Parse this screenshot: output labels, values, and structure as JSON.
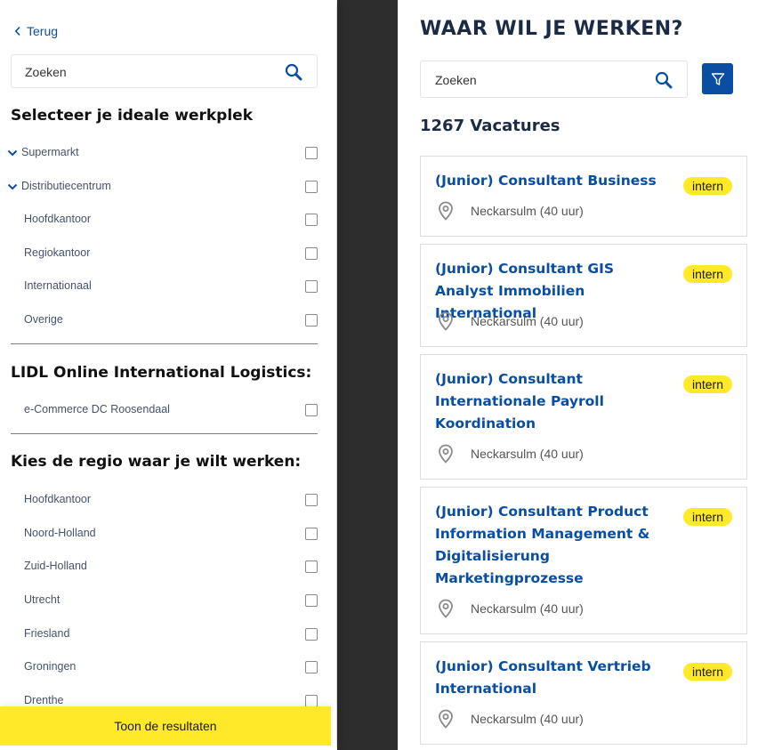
{
  "main": {
    "title": "WAAR WIL JE WERKEN?",
    "search_placeholder": "Zoeken",
    "count": "1267 Vacatures",
    "jobs": [
      {
        "title": "(Junior) Consultant Business",
        "badge": "intern",
        "location": "Neckarsulm (40 uur)"
      },
      {
        "title": "(Junior) Consultant GIS Analyst Immobilien International",
        "badge": "intern",
        "location": "Neckarsulm (40 uur)"
      },
      {
        "title": "(Junior) Consultant Internationale Payroll Koordination",
        "badge": "intern",
        "location": "Neckarsulm (40 uur)"
      },
      {
        "title": "(Junior) Consultant Product Information Management & Digitalisierung Marketingprozesse",
        "badge": "intern",
        "location": "Neckarsulm (40 uur)"
      },
      {
        "title": "(Junior) Consultant Vertrieb International",
        "badge": "intern",
        "location": "Neckarsulm (40 uur)"
      }
    ]
  },
  "panel": {
    "back_label": "Terug",
    "search_placeholder": "Zoeken",
    "section1_title": "Selecteer je ideale werkplek",
    "section1_items": [
      "Supermarkt",
      "Distributiecentrum",
      "Hoofdkantoor",
      "Regiokantoor",
      "Internationaal",
      "Overige"
    ],
    "section2_title": "LIDL Online International Logistics:",
    "section2_items": [
      "e-Commerce DC Roosendaal"
    ],
    "section3_title": "Kies de regio waar je wilt werken:",
    "section3_items": [
      "Hoofdkantoor",
      "Noord-Holland",
      "Zuid-Holland",
      "Utrecht",
      "Friesland",
      "Groningen",
      "Drenthe"
    ],
    "results_button": "Toon de resultaten"
  },
  "colors": {
    "brand_blue": "#0a4ea3",
    "brand_yellow": "#ffe929",
    "overlay_dark": "#2d2d2d"
  },
  "icons": {
    "search": "search-icon",
    "filter": "filter-icon",
    "location": "location-pin-icon",
    "back": "chevron-left-icon",
    "expand": "chevron-down-icon"
  }
}
